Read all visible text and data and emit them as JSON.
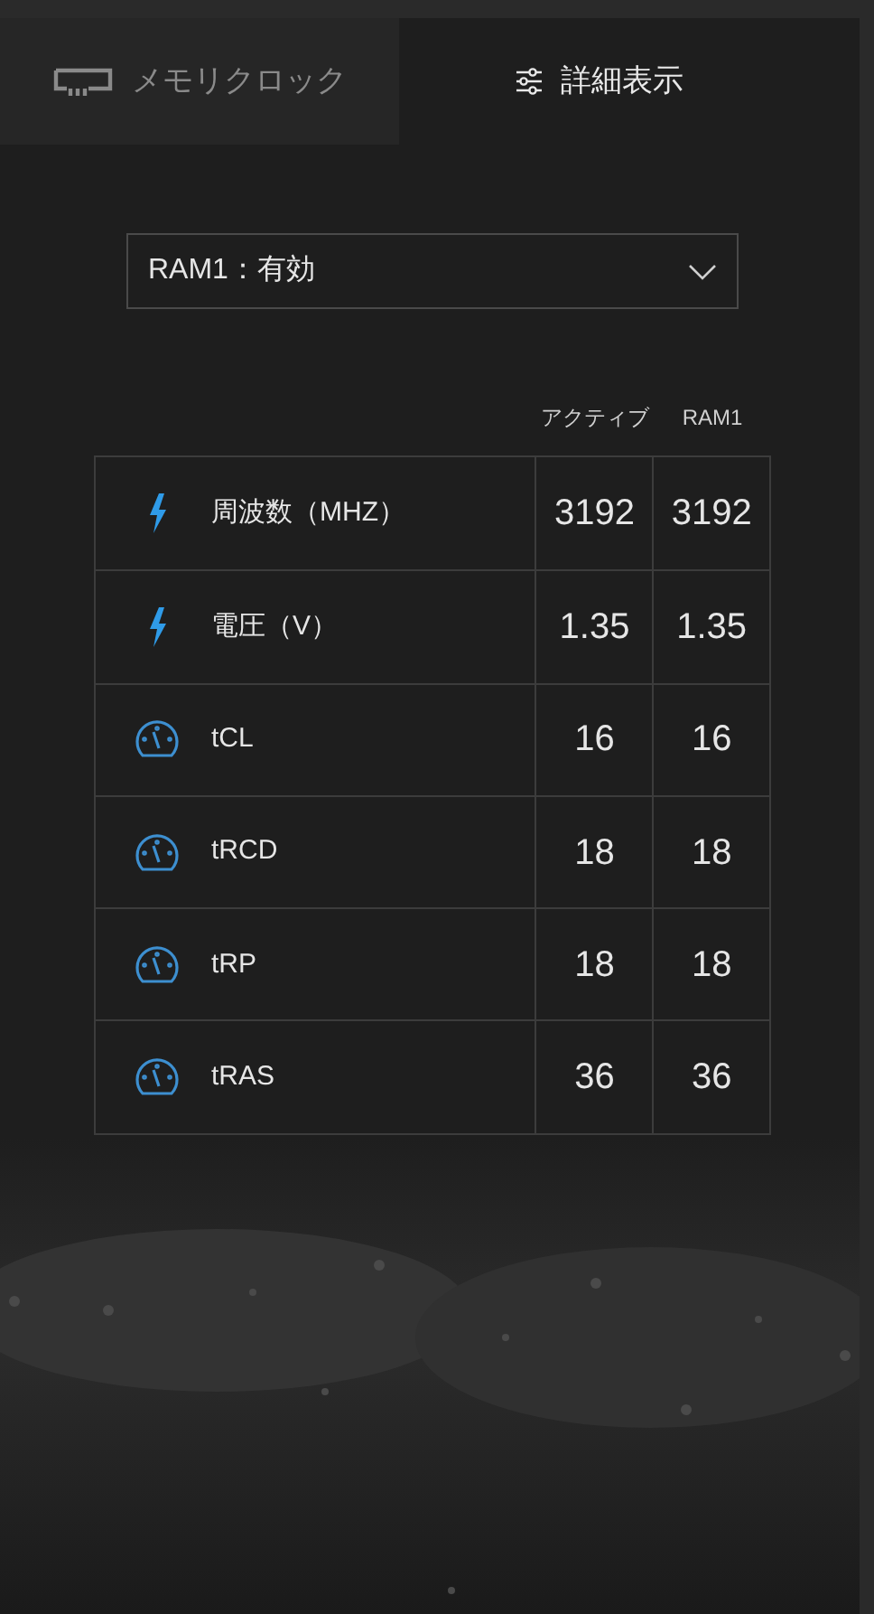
{
  "tabs": [
    {
      "label": "メモリクロック",
      "kind": "memory",
      "selected": false
    },
    {
      "label": "詳細表示",
      "kind": "sliders",
      "selected": true
    }
  ],
  "dropdown": {
    "value": "RAM1：有効"
  },
  "table": {
    "columns": [
      "アクティブ",
      "RAM1"
    ],
    "rows": [
      {
        "kind": "bolt",
        "label": "周波数（MHZ）",
        "values": [
          "3192",
          "3192"
        ]
      },
      {
        "kind": "bolt",
        "label": "電圧（V）",
        "values": [
          "1.35",
          "1.35"
        ]
      },
      {
        "kind": "gauge",
        "label": "tCL",
        "values": [
          "16",
          "16"
        ]
      },
      {
        "kind": "gauge",
        "label": "tRCD",
        "values": [
          "18",
          "18"
        ]
      },
      {
        "kind": "gauge",
        "label": "tRP",
        "values": [
          "18",
          "18"
        ]
      },
      {
        "kind": "gauge",
        "label": "tRAS",
        "values": [
          "36",
          "36"
        ]
      }
    ]
  }
}
